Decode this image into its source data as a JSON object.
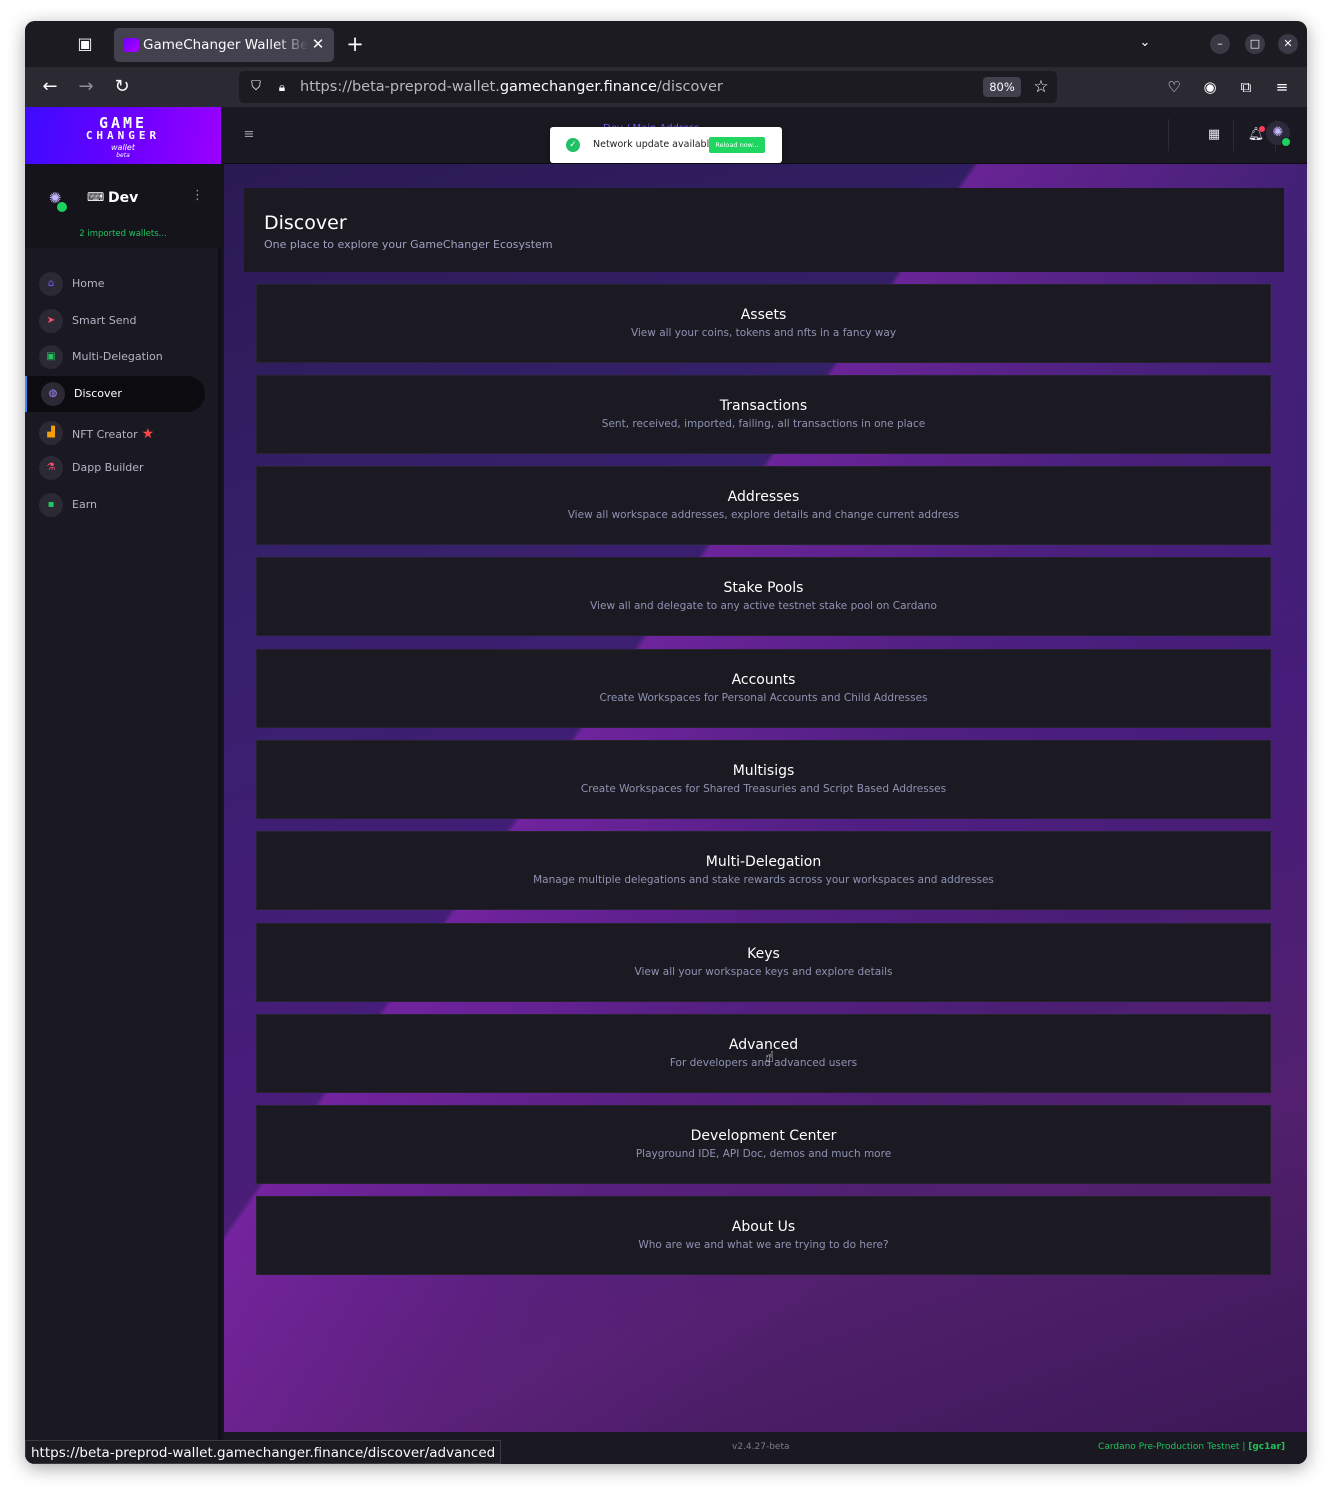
{
  "browser": {
    "tab_title": "GameChanger Wallet Beta",
    "url_prefix": "https://beta-preprod-wallet.",
    "url_host": "gamechanger.finance",
    "url_path": "/discover",
    "zoom": "80%",
    "status_url": "https://beta-preprod-wallet.gamechanger.finance/discover/advanced"
  },
  "app": {
    "logo_line1": "GAME",
    "logo_line2": "CHANGER",
    "logo_sub": "wallet",
    "logo_beta": "beta",
    "breadcrumb": "Dev / Main Address",
    "toast": {
      "message": "Network update available",
      "button": "Reload now..."
    },
    "wallet": {
      "name": "Dev",
      "subtitle": "2 imported wallets..."
    },
    "nav": [
      {
        "label": "Home",
        "icon": "home-icon",
        "color": "#7d5cff"
      },
      {
        "label": "Smart Send",
        "icon": "send-icon",
        "color": "#ff4d6d"
      },
      {
        "label": "Multi-Delegation",
        "icon": "gift-icon",
        "color": "#22c55e"
      },
      {
        "label": "Discover",
        "icon": "globe-icon",
        "color": "#a78bfa"
      },
      {
        "label": "NFT Creator",
        "icon": "factory-icon",
        "color": "#f59e0b"
      },
      {
        "label": "Dapp Builder",
        "icon": "flask-icon",
        "color": "#ff4d6d"
      },
      {
        "label": "Earn",
        "icon": "money-icon",
        "color": "#22c55e"
      }
    ],
    "page": {
      "title": "Discover",
      "subtitle": "One place to explore your GameChanger Ecosystem"
    },
    "cards": [
      {
        "title": "Assets",
        "subtitle": "View all your coins, tokens and nfts in a fancy way"
      },
      {
        "title": "Transactions",
        "subtitle": "Sent, received, imported, failing, all transactions in one place"
      },
      {
        "title": "Addresses",
        "subtitle": "View all workspace addresses, explore details and change current address"
      },
      {
        "title": "Stake Pools",
        "subtitle": "View all and delegate to any active testnet stake pool on Cardano"
      },
      {
        "title": "Accounts",
        "subtitle": "Create Workspaces for Personal Accounts and Child Addresses"
      },
      {
        "title": "Multisigs",
        "subtitle": "Create Workspaces for Shared Treasuries and Script Based Addresses"
      },
      {
        "title": "Multi-Delegation",
        "subtitle": "Manage multiple delegations and stake rewards across your workspaces and addresses"
      },
      {
        "title": "Keys",
        "subtitle": "View all your workspace keys and explore details"
      },
      {
        "title": "Advanced",
        "subtitle": "For developers and advanced users"
      },
      {
        "title": "Development Center",
        "subtitle": "Playground IDE, API Doc, demos and much more"
      },
      {
        "title": "About Us",
        "subtitle": "Who are we and what we are trying to do here?"
      }
    ],
    "footer": {
      "version": "v2.4.27-beta",
      "network": "Cardano Pre-Production Testnet | ",
      "network_id": "[gc1ar]"
    }
  }
}
